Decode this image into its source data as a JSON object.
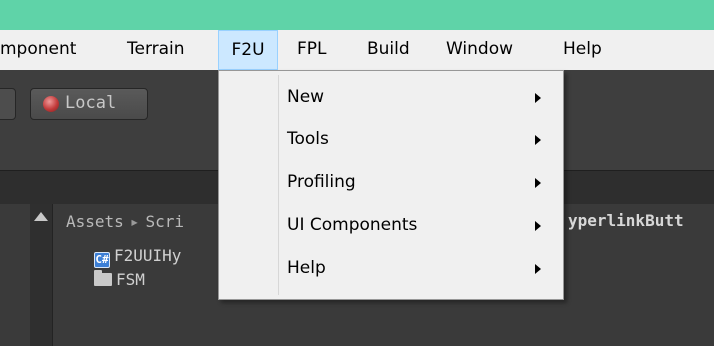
{
  "colors": {
    "titlebar": "#5fd3a8",
    "menu_highlight": "#cce8ff",
    "editor_bg": "#383838"
  },
  "menubar": {
    "items": [
      {
        "label": "mponent"
      },
      {
        "label": "Terrain"
      },
      {
        "label": "F2U",
        "active": true
      },
      {
        "label": "FPL"
      },
      {
        "label": "Build"
      },
      {
        "label": "Window"
      },
      {
        "label": "Help"
      }
    ]
  },
  "toolbar": {
    "local_label": "Local",
    "local_icon": "globe-icon"
  },
  "project_panel": {
    "breadcrumb": [
      "Assets",
      "Scri"
    ],
    "breadcrumb_right": "yperlinkButt",
    "files": [
      {
        "icon": "csharp-script-icon",
        "icon_glyph": "C#",
        "name": "F2UUIHy"
      },
      {
        "icon": "folder-icon",
        "name": "FSM"
      }
    ]
  },
  "dropdown": {
    "items": [
      {
        "label": "New",
        "has_submenu": true
      },
      {
        "label": "Tools",
        "has_submenu": true
      },
      {
        "label": "Profiling",
        "has_submenu": true
      },
      {
        "label": "UI Components",
        "has_submenu": true
      },
      {
        "label": "Help",
        "has_submenu": true
      }
    ]
  }
}
